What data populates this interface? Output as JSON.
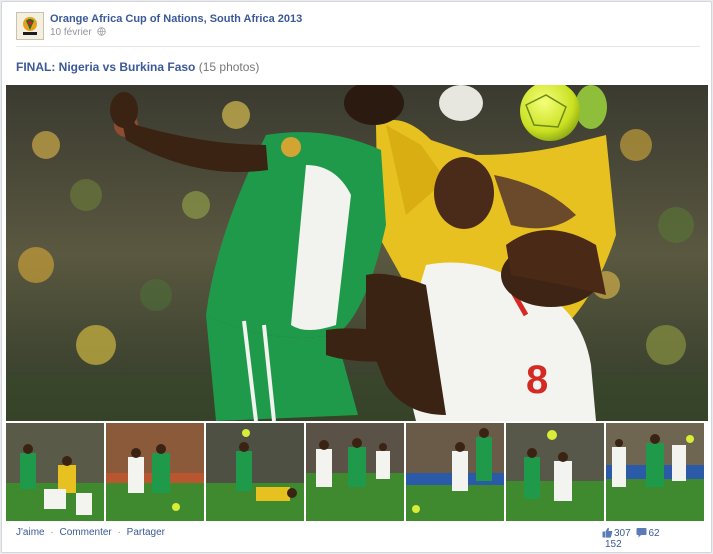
{
  "post": {
    "page_name": "Orange Africa Cup of Nations, South Africa 2013",
    "date": "10 février",
    "album_title": "FINAL: Nigeria vs Burkina Faso",
    "album_count": "(15 photos)"
  },
  "actions": {
    "like": "J'aime",
    "comment": "Commenter",
    "share": "Partager",
    "separator": "·"
  },
  "stats": {
    "likes": "307",
    "comments": "62",
    "shares": "152"
  },
  "photo": {
    "jersey_number": "8"
  },
  "colors": {
    "link": "#3b5998",
    "nigeria_green": "#1f9a4b",
    "burkina_yellow": "#e7c11f",
    "pitch_green": "#3f8a2e"
  },
  "icons": {
    "avatar": "afcon-logo-icon",
    "privacy": "globe-icon",
    "likes": "thumbs-up-icon",
    "comments": "comment-icon"
  }
}
